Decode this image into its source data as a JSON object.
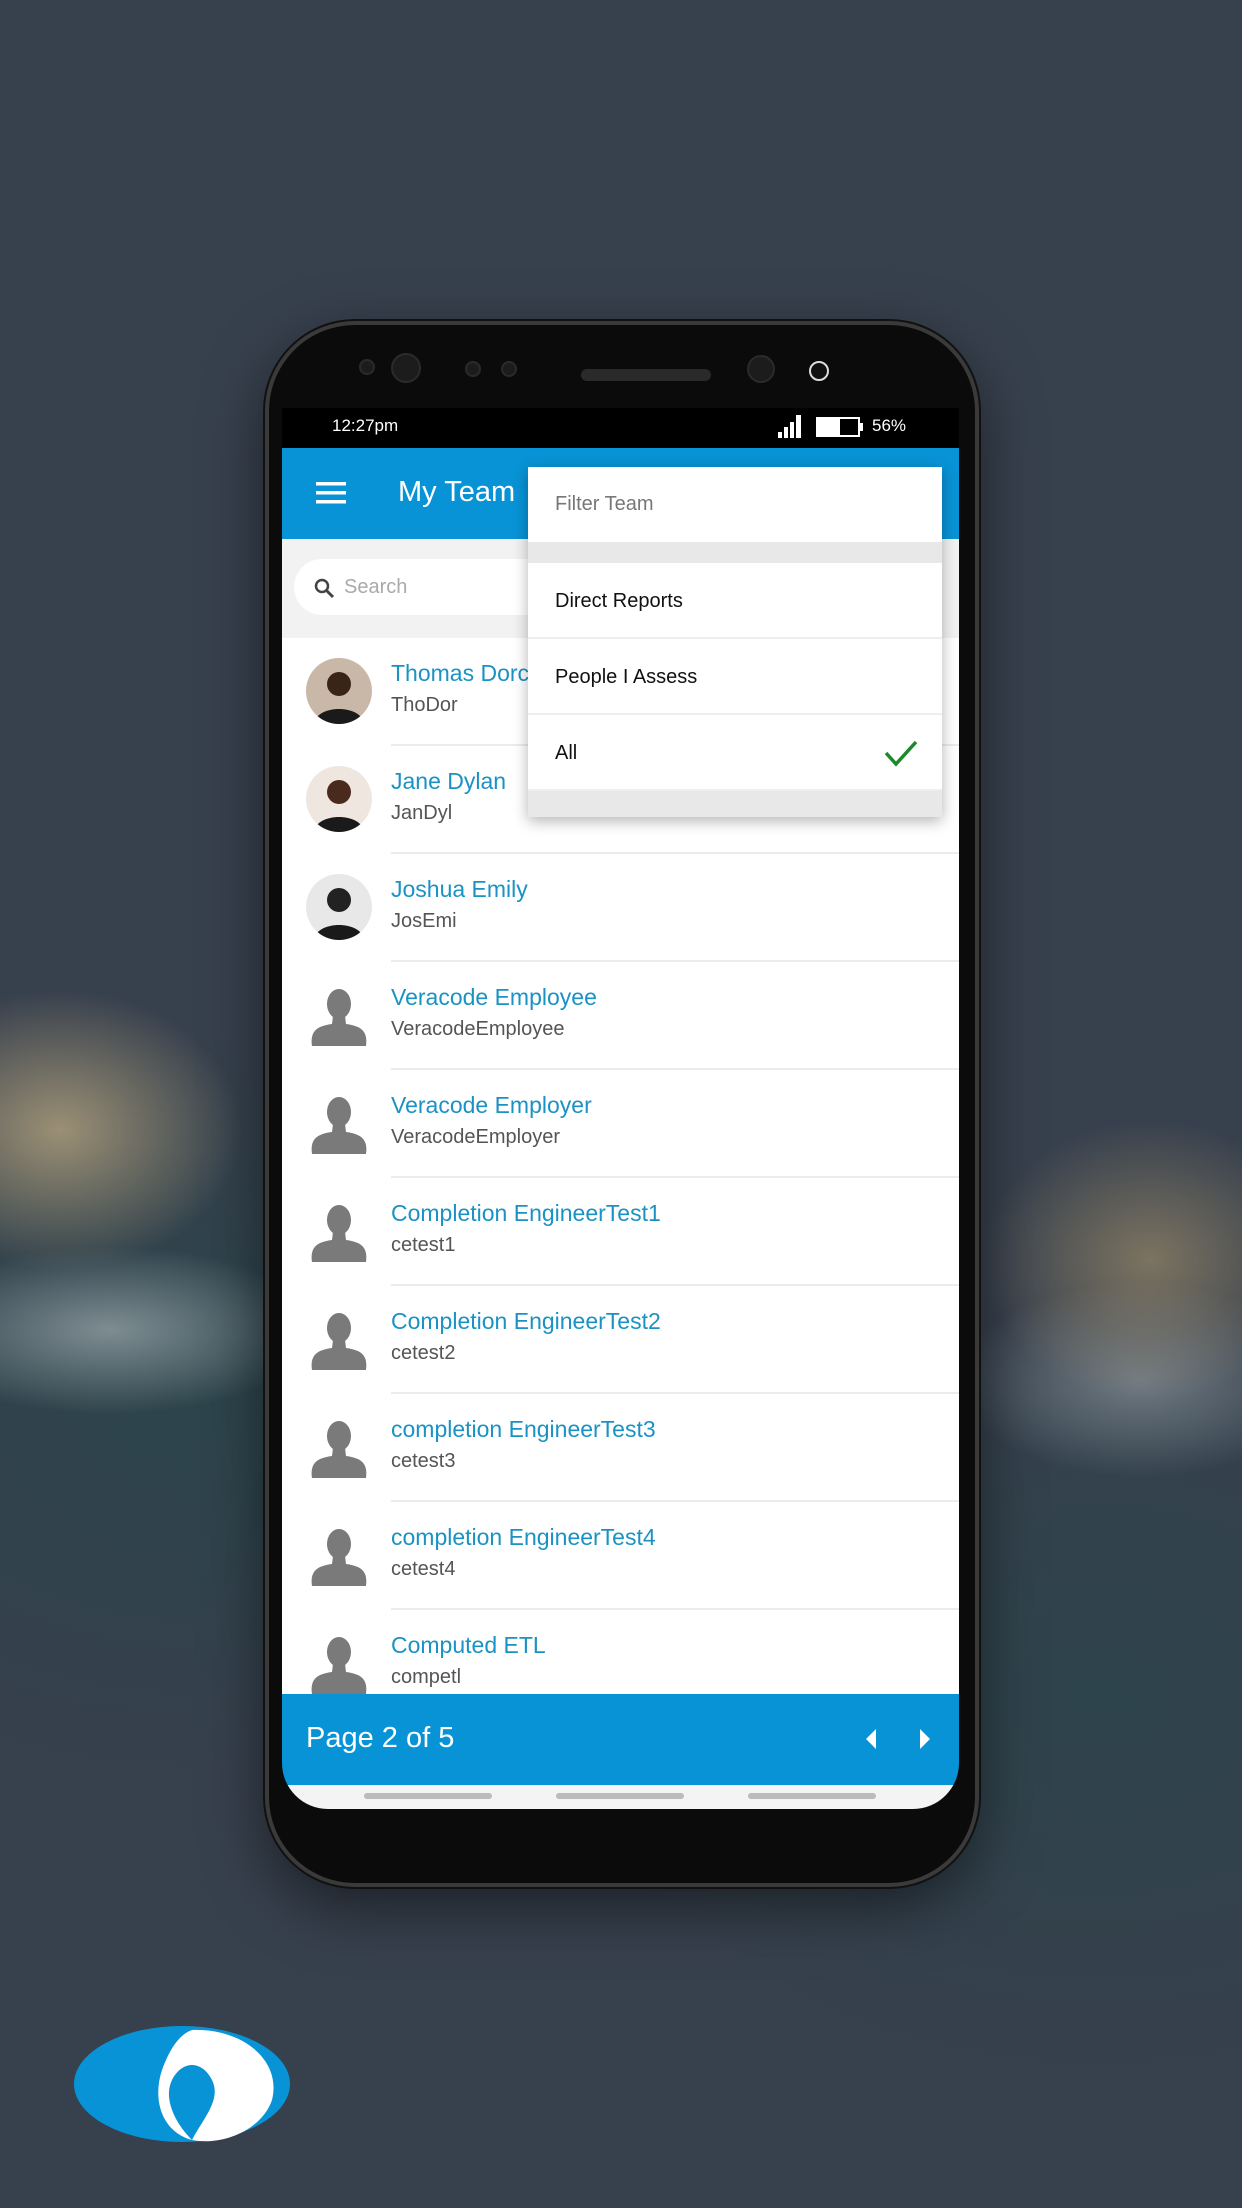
{
  "status": {
    "time": "12:27pm",
    "battery": "56%",
    "battery_level": 56
  },
  "header": {
    "title": "My Team",
    "menu_icon": "hamburger-icon"
  },
  "search": {
    "placeholder": "Search"
  },
  "filter": {
    "title": "Filter Team",
    "options": [
      {
        "label": "Direct Reports",
        "selected": false
      },
      {
        "label": "People I Assess",
        "selected": false
      },
      {
        "label": "All",
        "selected": true
      }
    ],
    "check_color": "#1a8a2a"
  },
  "people": [
    {
      "name": "Thomas Dorc",
      "username": "ThoDor",
      "photo": true
    },
    {
      "name": "Jane Dylan",
      "username": "JanDyl",
      "photo": true
    },
    {
      "name": "Joshua Emily",
      "username": "JosEmi",
      "photo": true
    },
    {
      "name": "Veracode Employee",
      "username": "VeracodeEmployee",
      "photo": false
    },
    {
      "name": "Veracode Employer",
      "username": "VeracodeEmployer",
      "photo": false
    },
    {
      "name": "Completion EngineerTest1",
      "username": "cetest1",
      "photo": false
    },
    {
      "name": "Completion EngineerTest2",
      "username": "cetest2",
      "photo": false
    },
    {
      "name": "completion EngineerTest3",
      "username": "cetest3",
      "photo": false
    },
    {
      "name": "completion EngineerTest4",
      "username": "cetest4",
      "photo": false
    },
    {
      "name": "Computed ETL",
      "username": "competl",
      "photo": false
    }
  ],
  "footer": {
    "page_label": "Page 2 of 5"
  },
  "colors": {
    "brand": "#0893d6",
    "name": "#1a93c4"
  }
}
